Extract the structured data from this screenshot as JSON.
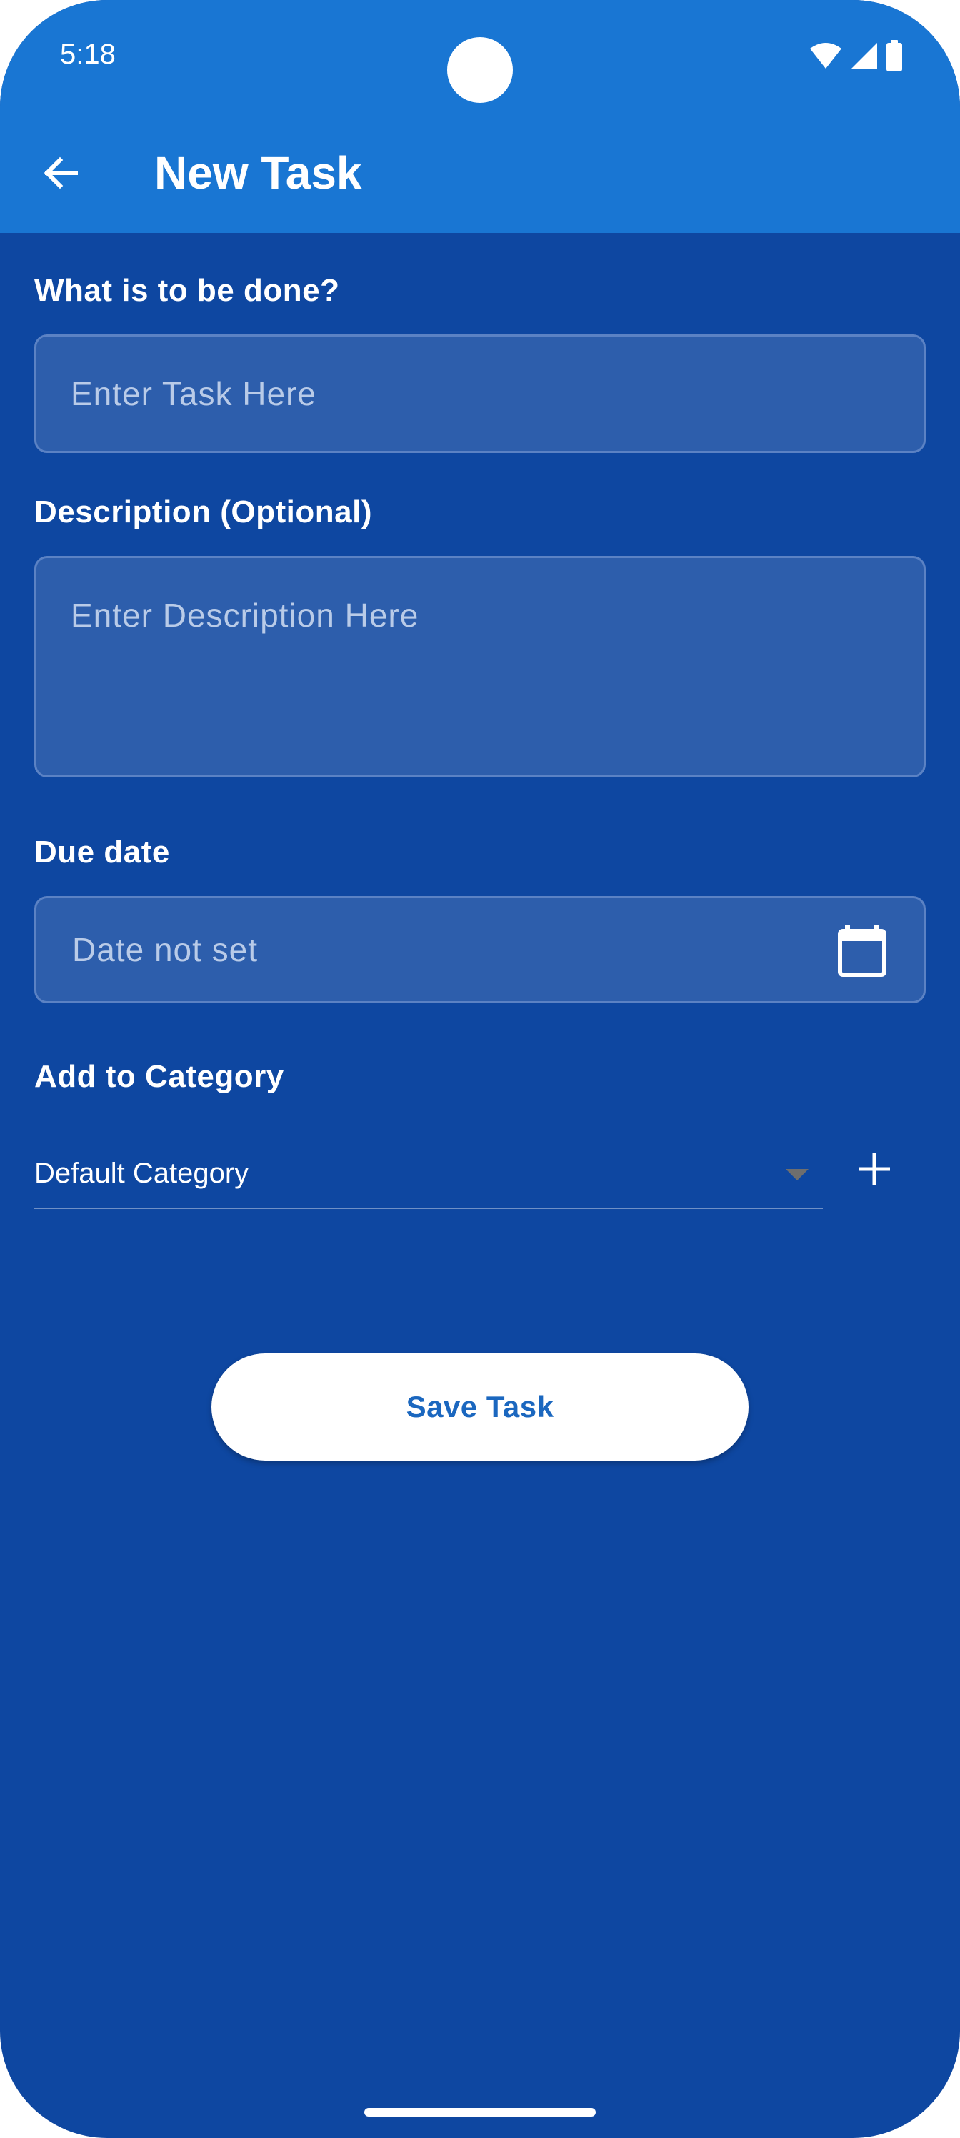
{
  "status_bar": {
    "time": "5:18",
    "icons": [
      "wifi-icon",
      "cellular-signal-icon",
      "battery-icon"
    ]
  },
  "app_bar": {
    "back_icon": "arrow-left-icon",
    "title": "New Task"
  },
  "form": {
    "task_label": "What is to be done?",
    "task_placeholder": "Enter Task Here",
    "task_value": "",
    "description_label": "Description (Optional)",
    "description_placeholder": "Enter Description Here",
    "description_value": "",
    "due_date_label": "Due date",
    "due_date_value": "Date not set",
    "due_date_icon": "calendar-icon",
    "category_label": "Add to Category",
    "category_selected": "Default Category",
    "category_dropdown_icon": "caret-down-icon",
    "add_category_icon": "plus-icon",
    "save_label": "Save Task"
  },
  "colors": {
    "app_bar": "#1976d3",
    "background": "#0e47a1",
    "field_fill": "#2d5eac",
    "field_border": "#5b82c4",
    "save_text": "#1b67bf"
  }
}
